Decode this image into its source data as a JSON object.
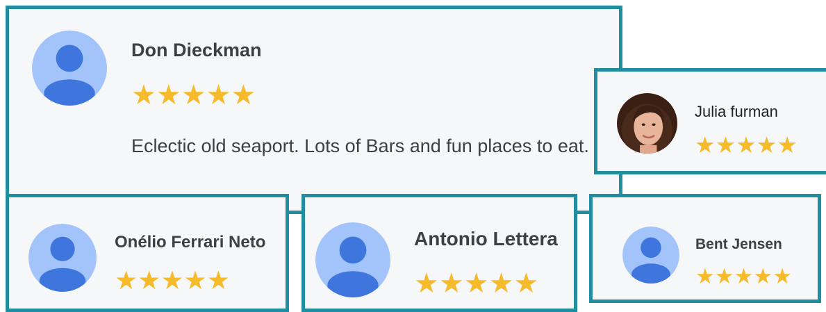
{
  "colors": {
    "border": "#218ea0",
    "card_bg": "#f6f7f9",
    "star": "#f6bb2c",
    "avatar_bg": "#a2c4fa",
    "avatar_fg": "#3e76de",
    "text": "#3c4043"
  },
  "reviews": [
    {
      "name": "Don Dieckman",
      "rating": 5,
      "text": "Eclectic old seaport. Lots of Bars and fun places to eat.",
      "avatar": "default-person-icon"
    },
    {
      "name": "Julia furman",
      "rating": 5,
      "avatar": "profile-photo"
    },
    {
      "name": "Onélio Ferrari Neto",
      "rating": 5,
      "avatar": "default-person-icon"
    },
    {
      "name": "Antonio Lettera",
      "rating": 5,
      "avatar": "default-person-icon"
    },
    {
      "name": "Bent Jensen",
      "rating": 5,
      "avatar": "default-person-icon"
    }
  ]
}
